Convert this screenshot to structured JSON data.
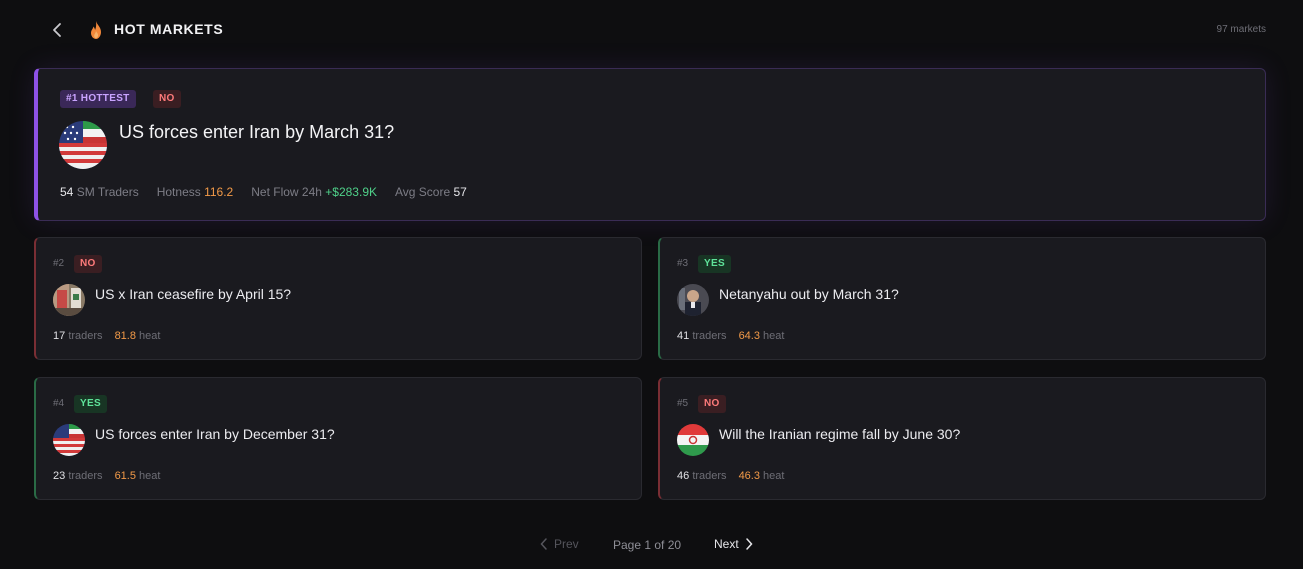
{
  "header": {
    "title": "HOT MARKETS",
    "count": "97 markets",
    "icons": {
      "back": "chevron-left-icon",
      "flame": "flame-icon"
    }
  },
  "featured": {
    "rank_badge": "#1 HOTTEST",
    "side": "NO",
    "question": "US forces enter Iran by March 31?",
    "stats": {
      "traders_value": "54",
      "traders_label": "SM Traders",
      "hotness_label": "Hotness",
      "hotness_value": "116.2",
      "netflow_label": "Net Flow 24h",
      "netflow_value": "+$283.9K",
      "avgscore_label": "Avg Score",
      "avgscore_value": "57"
    },
    "accent": "#8e52e6"
  },
  "markets": [
    {
      "rank": "#2",
      "side": "NO",
      "question": "US x Iran ceasefire by April 15?",
      "traders": "17",
      "traders_label": "traders",
      "heat": "81.8",
      "heat_label": "heat"
    },
    {
      "rank": "#3",
      "side": "YES",
      "question": "Netanyahu out by March 31?",
      "traders": "41",
      "traders_label": "traders",
      "heat": "64.3",
      "heat_label": "heat"
    },
    {
      "rank": "#4",
      "side": "YES",
      "question": "US forces enter Iran by December 31?",
      "traders": "23",
      "traders_label": "traders",
      "heat": "61.5",
      "heat_label": "heat"
    },
    {
      "rank": "#5",
      "side": "NO",
      "question": "Will the Iranian regime fall by June 30?",
      "traders": "46",
      "traders_label": "traders",
      "heat": "46.3",
      "heat_label": "heat"
    }
  ],
  "pagination": {
    "prev_label": "Prev",
    "page_info": "Page 1 of 20",
    "next_label": "Next"
  },
  "colors": {
    "no": "#ff7b7b",
    "yes": "#5fe39a",
    "heat": "#f29a48",
    "positive": "#4fd089"
  }
}
